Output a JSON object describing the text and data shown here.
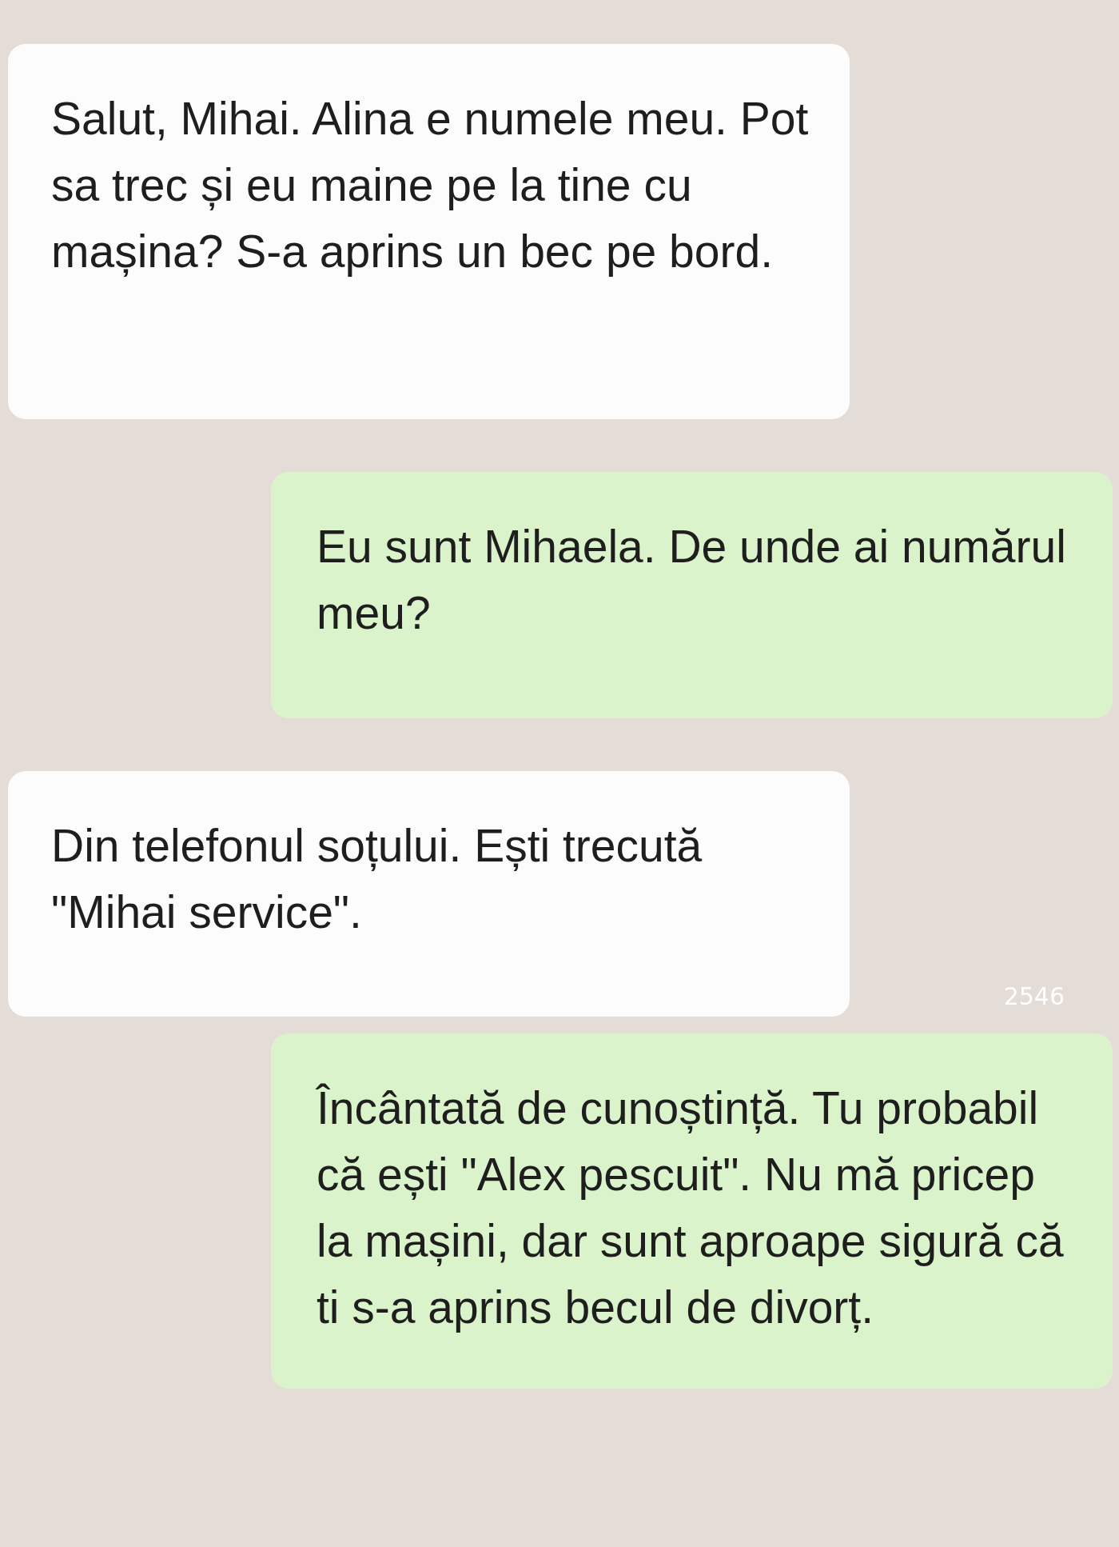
{
  "messages": [
    {
      "kind": "incoming",
      "text": "Salut, Mihai. Alina e numele meu. Pot sa trec și eu maine pe la tine cu mașina? S-a aprins un bec pe bord."
    },
    {
      "kind": "outgoing",
      "text": "Eu sunt Mihaela. De unde ai numărul meu?"
    },
    {
      "kind": "incoming",
      "text": "Din telefonul soțului. Ești trecută \"Mihai service\"."
    },
    {
      "kind": "outgoing",
      "text": "Încântată de cunoștință. Tu probabil că ești \"Alex pescuit\". Nu mă pricep la mașini, dar sunt aproape sigură că ti s-a aprins becul de divorț."
    }
  ],
  "footer_note": "2546"
}
